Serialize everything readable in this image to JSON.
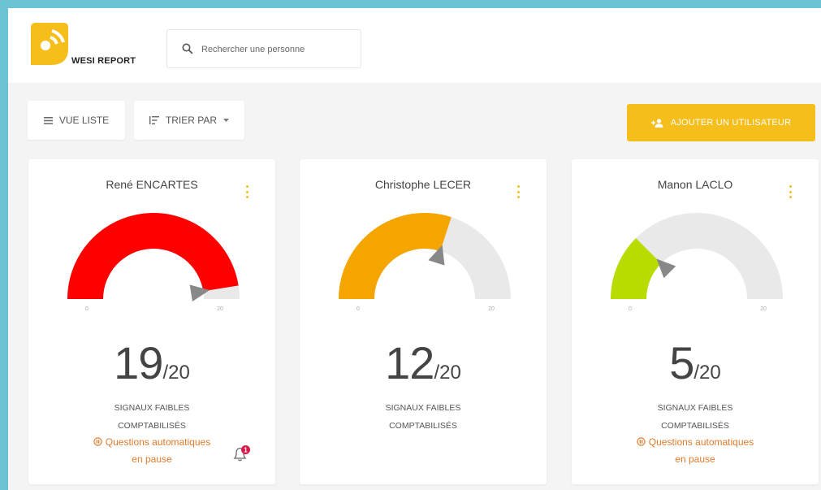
{
  "app": {
    "brand": "WESI REPORT",
    "accent": "#f5be1b"
  },
  "search": {
    "placeholder": "Rechercher une personne"
  },
  "toolbar": {
    "list_view_label": "VUE LISTE",
    "sort_label": "TRIER PAR",
    "add_user_label": "AJOUTER UN UTILISATEUR"
  },
  "cards": [
    {
      "name": "René ENCARTES",
      "score": "19",
      "max": "/20",
      "gauge_min": "0",
      "gauge_max": "20",
      "value": 19,
      "color": "#ff0000",
      "signal_line1": "SIGNAUX FAIBLES",
      "signal_line2": "COMPTABILISÉS",
      "pause_line1": "Questions automatiques",
      "pause_line2": "en pause",
      "notification_count": "1"
    },
    {
      "name": "Christophe LECER",
      "score": "12",
      "max": "/20",
      "gauge_min": "0",
      "gauge_max": "20",
      "value": 12,
      "color": "#f5a500",
      "signal_line1": "SIGNAUX FAIBLES",
      "signal_line2": "COMPTABILISÉS"
    },
    {
      "name": "Manon LACLO",
      "score": "5",
      "max": "/20",
      "gauge_min": "0",
      "gauge_max": "20",
      "value": 5,
      "color": "#b9dc00",
      "signal_line1": "SIGNAUX FAIBLES",
      "signal_line2": "COMPTABILISÉS",
      "pause_line1": "Questions automatiques",
      "pause_line2": "en pause"
    }
  ]
}
